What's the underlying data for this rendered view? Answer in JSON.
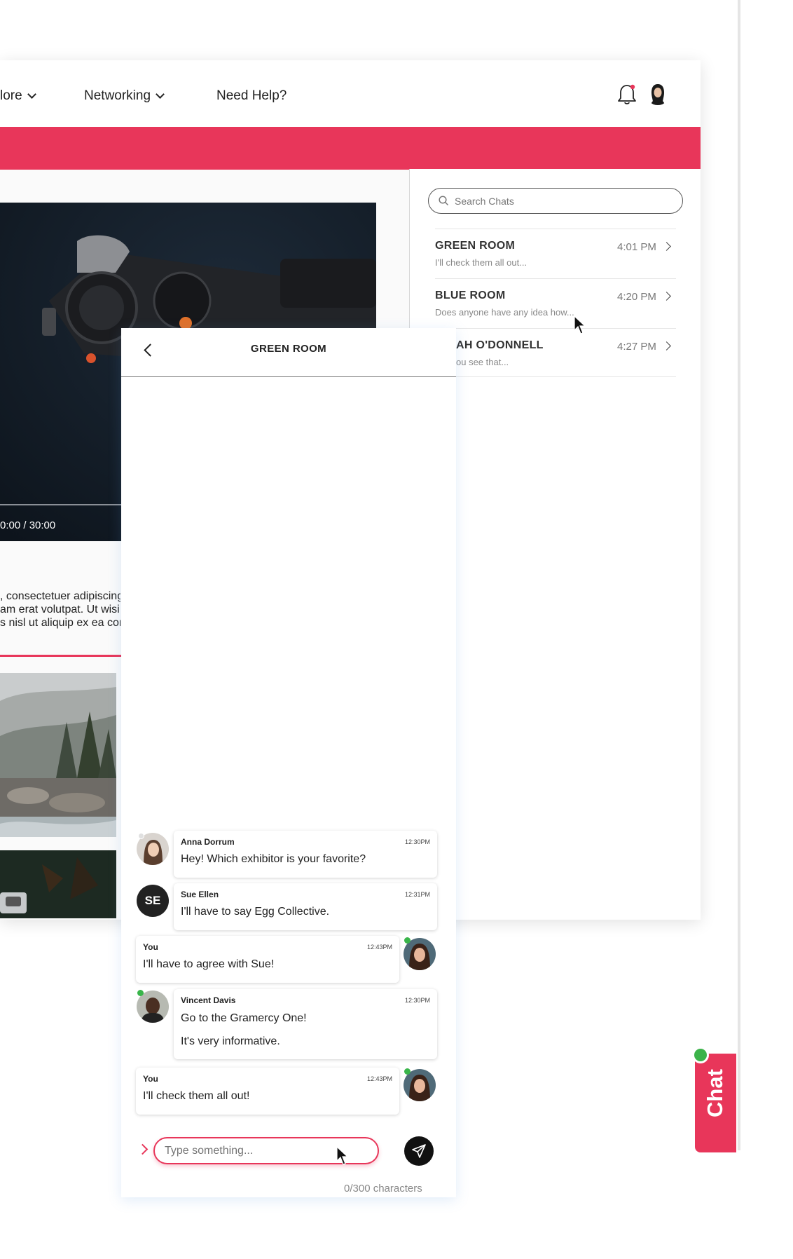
{
  "nav": {
    "explore_label": "lore",
    "networking_label": "Networking",
    "help_label": "Need Help?"
  },
  "video": {
    "time": "0:00 / 30:00"
  },
  "description": {
    "line1": ", consectetuer adipiscing",
    "line2": "am erat volutpat. Ut wisi e",
    "line3": "s nisl ut aliquip ex ea com"
  },
  "chat_list": {
    "search_placeholder": "Search Chats",
    "items": [
      {
        "title": "GREEN ROOM",
        "preview": "I'll check them all out...",
        "time": "4:01 PM"
      },
      {
        "title": "BLUE ROOM",
        "preview": "Does anyone have any idea how...",
        "time": "4:20 PM"
      },
      {
        "title": "AH O'DONNELL",
        "preview": "ou see that...",
        "time": "4:27 PM"
      }
    ]
  },
  "conversation": {
    "title": "GREEN ROOM",
    "messages": [
      {
        "name": "Anna Dorrum",
        "time": "12:30PM",
        "text": "Hey! Which exhibitor is your favorite?"
      },
      {
        "name": "Sue Ellen",
        "initials": "SE",
        "time": "12:31PM",
        "text": "I'll have to say Egg Collective."
      },
      {
        "name": "You",
        "time": "12:43PM",
        "text": "I'll have to agree with Sue!"
      },
      {
        "name": "Vincent Davis",
        "time": "12:30PM",
        "text": "Go to the Gramercy One!",
        "text2": "It's very informative."
      },
      {
        "name": "You",
        "time": "12:43PM",
        "text": "I'll check them all out!"
      }
    ],
    "composer_placeholder": "Type something...",
    "char_count": "0/300 characters"
  },
  "chat_tab": {
    "label": "Chat"
  },
  "colors": {
    "accent": "#e8365a",
    "online": "#39b54a"
  }
}
